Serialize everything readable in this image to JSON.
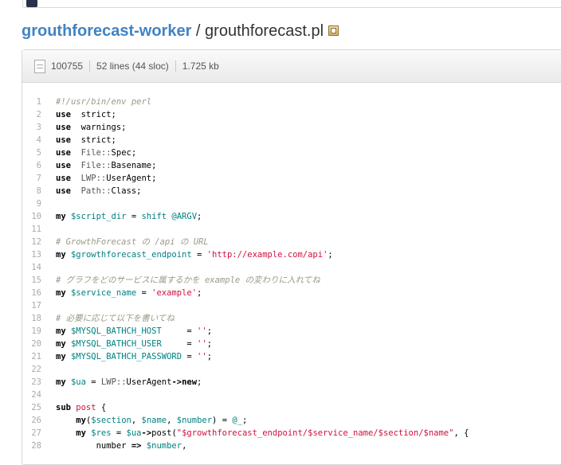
{
  "breadcrumb": {
    "repo": "grouthforecast-worker",
    "separator": " / ",
    "file": "grouthforecast.pl",
    "icon": "clipboard-icon"
  },
  "file_meta": {
    "mode": "100755",
    "lines": "52 lines (44 sloc)",
    "size": "1.725 kb",
    "icon": "file-text-icon"
  },
  "code": [
    {
      "n": "1",
      "t": [
        [
          "cm",
          "#!/usr/bin/env perl"
        ]
      ]
    },
    {
      "n": "2",
      "t": [
        [
          "kw",
          "use"
        ],
        [
          "",
          "  strict;"
        ]
      ]
    },
    {
      "n": "3",
      "t": [
        [
          "kw",
          "use"
        ],
        [
          "",
          "  warnings;"
        ]
      ]
    },
    {
      "n": "4",
      "t": [
        [
          "kw",
          "use"
        ],
        [
          "",
          "  strict;"
        ]
      ]
    },
    {
      "n": "5",
      "t": [
        [
          "kw",
          "use"
        ],
        [
          "pkg",
          "  File::"
        ],
        [
          "",
          "Spec;"
        ]
      ]
    },
    {
      "n": "6",
      "t": [
        [
          "kw",
          "use"
        ],
        [
          "pkg",
          "  File::"
        ],
        [
          "",
          "Basename;"
        ]
      ]
    },
    {
      "n": "7",
      "t": [
        [
          "kw",
          "use"
        ],
        [
          "pkg",
          "  LWP::"
        ],
        [
          "",
          "UserAgent;"
        ]
      ]
    },
    {
      "n": "8",
      "t": [
        [
          "kw",
          "use"
        ],
        [
          "pkg",
          "  Path::"
        ],
        [
          "",
          "Class;"
        ]
      ]
    },
    {
      "n": "9",
      "t": []
    },
    {
      "n": "10",
      "t": [
        [
          "kw",
          "my"
        ],
        [
          "var",
          " $script_dir"
        ],
        [
          "",
          " = "
        ],
        [
          "var",
          "shift @ARGV"
        ],
        [
          "",
          ";"
        ]
      ]
    },
    {
      "n": "11",
      "t": []
    },
    {
      "n": "12",
      "t": [
        [
          "cm",
          "# GrowthForecast の /api の URL"
        ]
      ]
    },
    {
      "n": "13",
      "t": [
        [
          "kw",
          "my"
        ],
        [
          "var",
          " $growthforecast_endpoint"
        ],
        [
          "",
          " = "
        ],
        [
          "str",
          "'http://example.com/api'"
        ],
        [
          "",
          ";"
        ]
      ]
    },
    {
      "n": "14",
      "t": []
    },
    {
      "n": "15",
      "t": [
        [
          "cm",
          "# グラフをどのサービスに属するかを example の変わりに入れてね"
        ]
      ]
    },
    {
      "n": "16",
      "t": [
        [
          "kw",
          "my"
        ],
        [
          "var",
          " $service_name"
        ],
        [
          "",
          " = "
        ],
        [
          "str",
          "'example'"
        ],
        [
          "",
          ";"
        ]
      ]
    },
    {
      "n": "17",
      "t": []
    },
    {
      "n": "18",
      "t": [
        [
          "cm",
          "# 必要に応じて以下を書いてね"
        ]
      ]
    },
    {
      "n": "19",
      "t": [
        [
          "kw",
          "my"
        ],
        [
          "var",
          " $MYSQL_BATHCH_HOST"
        ],
        [
          "",
          "     = "
        ],
        [
          "str",
          "''"
        ],
        [
          "",
          ";"
        ]
      ]
    },
    {
      "n": "20",
      "t": [
        [
          "kw",
          "my"
        ],
        [
          "var",
          " $MYSQL_BATHCH_USER"
        ],
        [
          "",
          "     = "
        ],
        [
          "str",
          "''"
        ],
        [
          "",
          ";"
        ]
      ]
    },
    {
      "n": "21",
      "t": [
        [
          "kw",
          "my"
        ],
        [
          "var",
          " $MYSQL_BATHCH_PASSWORD"
        ],
        [
          "",
          " = "
        ],
        [
          "str",
          "''"
        ],
        [
          "",
          ";"
        ]
      ]
    },
    {
      "n": "22",
      "t": []
    },
    {
      "n": "23",
      "t": [
        [
          "kw",
          "my"
        ],
        [
          "var",
          " $ua"
        ],
        [
          "",
          " = "
        ],
        [
          "pkg",
          "LWP::"
        ],
        [
          "",
          "UserAgent"
        ],
        [
          "bold",
          "->new"
        ],
        [
          "",
          ";"
        ]
      ]
    },
    {
      "n": "24",
      "t": []
    },
    {
      "n": "25",
      "t": [
        [
          "kw",
          "sub"
        ],
        [
          "str",
          " post"
        ],
        [
          "",
          " {"
        ]
      ]
    },
    {
      "n": "26",
      "t": [
        [
          "",
          "    "
        ],
        [
          "kw",
          "my"
        ],
        [
          "",
          "("
        ],
        [
          "var",
          "$section"
        ],
        [
          "",
          ", "
        ],
        [
          "var",
          "$name"
        ],
        [
          "",
          ", "
        ],
        [
          "var",
          "$number"
        ],
        [
          "",
          ") = "
        ],
        [
          "var",
          "@_"
        ],
        [
          "",
          ";"
        ]
      ]
    },
    {
      "n": "27",
      "t": [
        [
          "",
          "    "
        ],
        [
          "kw",
          "my"
        ],
        [
          "var",
          " $res"
        ],
        [
          "",
          " = "
        ],
        [
          "var",
          "$ua"
        ],
        [
          "bold",
          "->"
        ],
        [
          "",
          "post("
        ],
        [
          "str",
          "\"$growthforecast_endpoint/$service_name/$section/$name\""
        ],
        [
          "",
          ", {"
        ]
      ]
    },
    {
      "n": "28",
      "t": [
        [
          "",
          "        number "
        ],
        [
          "bold",
          "=>"
        ],
        [
          "var",
          " $number"
        ],
        [
          "",
          ","
        ]
      ]
    }
  ]
}
